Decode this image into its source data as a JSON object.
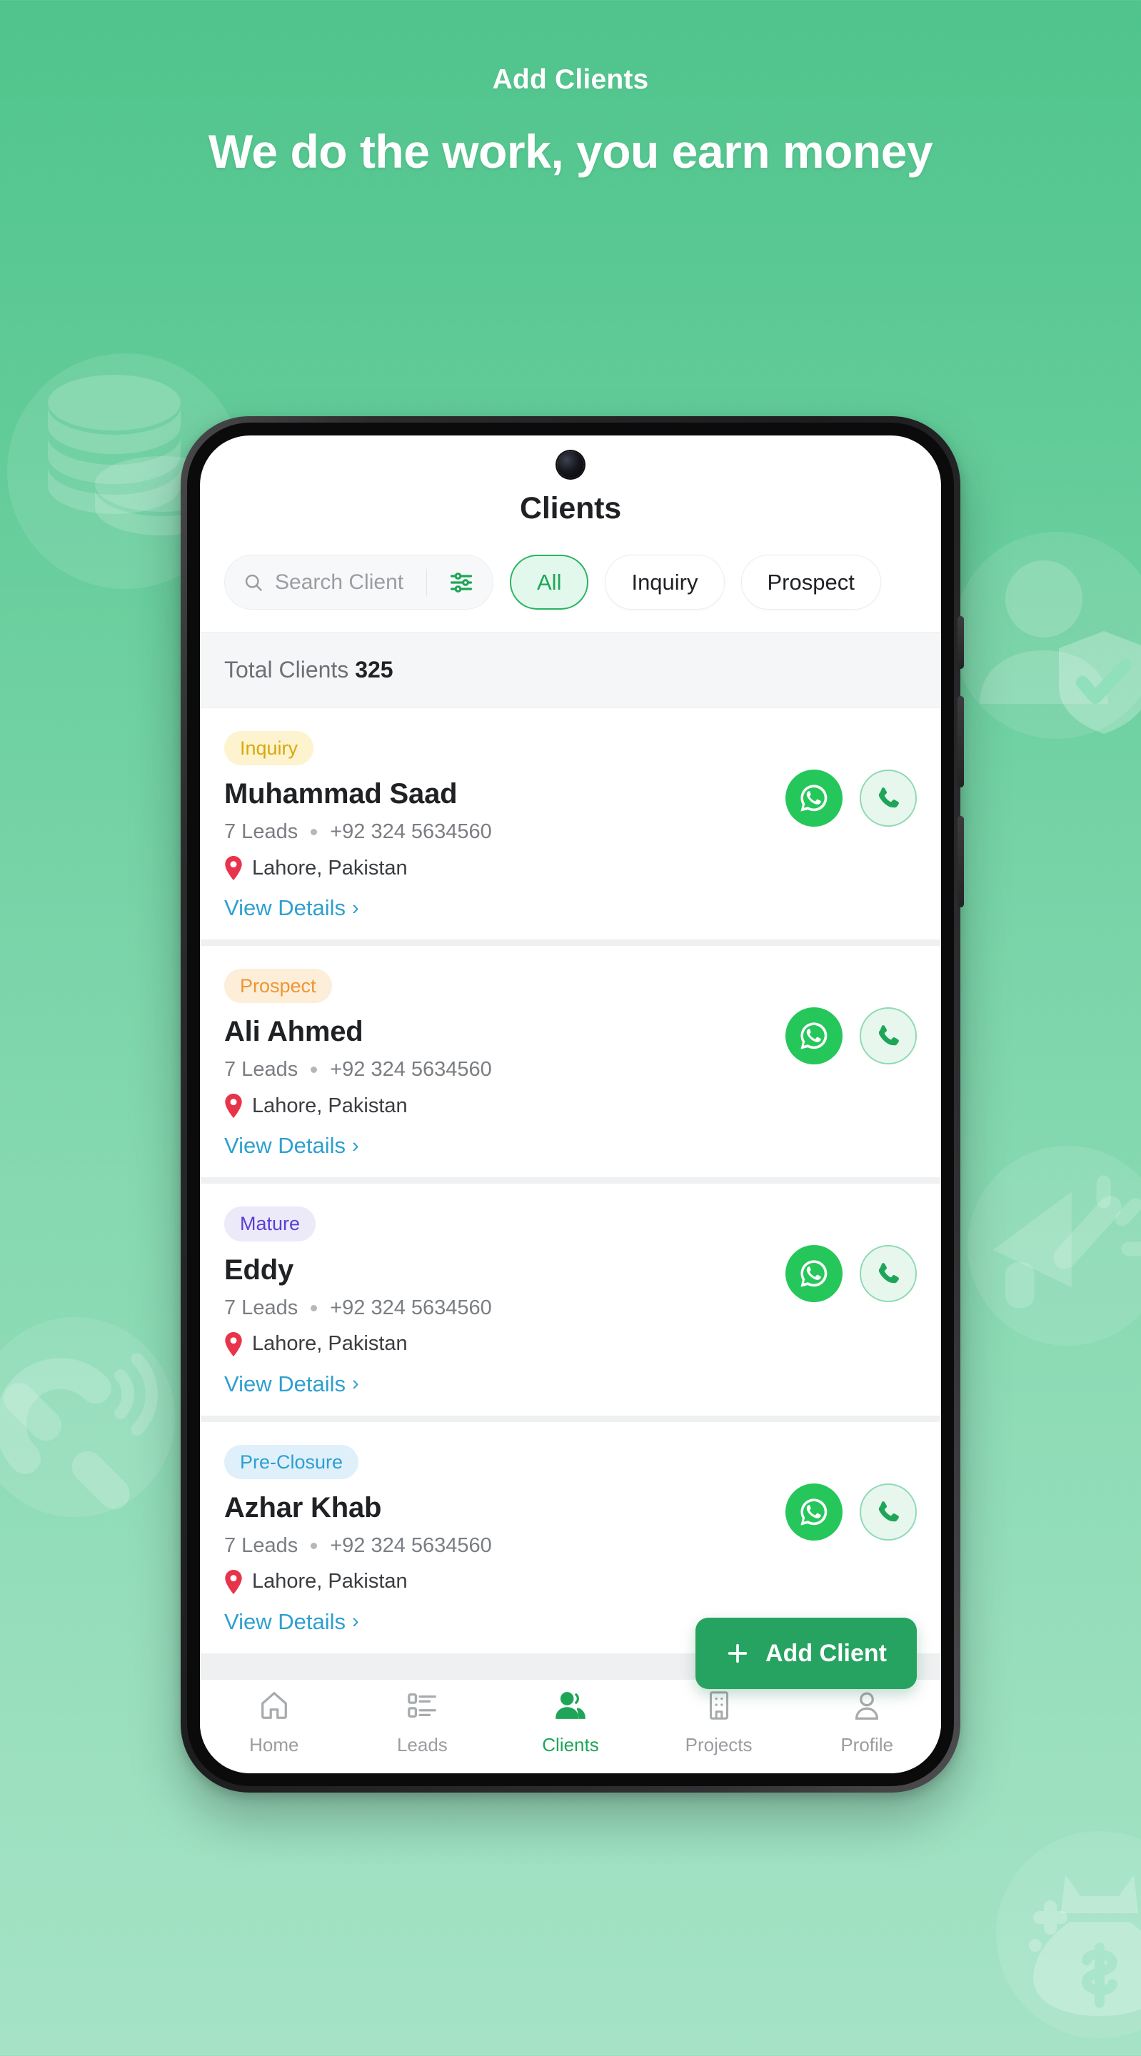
{
  "hero": {
    "eyebrow": "Add Clients",
    "title": "We do the work, you earn money"
  },
  "colors": {
    "brand_green": "#27a361",
    "accent_green": "#25c75a",
    "link_blue": "#2e9fd1",
    "pin_red": "#e8344a",
    "page_bg_top": "#4fc48c",
    "page_bg_bottom": "#a6e3c6"
  },
  "decorations": [
    {
      "name": "coins-icon"
    },
    {
      "name": "user-verified-icon"
    },
    {
      "name": "magnet-icon"
    },
    {
      "name": "megaphone-icon"
    },
    {
      "name": "money-bag-icon"
    }
  ],
  "app": {
    "title": "Clients",
    "search": {
      "placeholder": "Search Client",
      "value": ""
    },
    "chips": [
      {
        "label": "All",
        "active": true
      },
      {
        "label": "Inquiry",
        "active": false
      },
      {
        "label": "Prospect",
        "active": false
      }
    ],
    "total_label": "Total Clients",
    "total_count": "325",
    "view_details_label": "View Details",
    "chevron": "›",
    "add_button_label": "Add Client",
    "clients": [
      {
        "badge": "Inquiry",
        "badge_bg": "#fdf3cf",
        "badge_fg": "#d7a90c",
        "name": "Muhammad Saad",
        "leads": "7 Leads",
        "phone": "+92 324 5634560",
        "location": "Lahore, Pakistan"
      },
      {
        "badge": "Prospect",
        "badge_bg": "#fdeed9",
        "badge_fg": "#ef9533",
        "name": "Ali Ahmed",
        "leads": "7 Leads",
        "phone": "+92 324 5634560",
        "location": "Lahore, Pakistan"
      },
      {
        "badge": "Mature",
        "badge_bg": "#eceaf8",
        "badge_fg": "#5b3fd6",
        "name": "Eddy",
        "leads": "7 Leads",
        "phone": "+92 324 5634560",
        "location": "Lahore, Pakistan"
      },
      {
        "badge": "Pre-Closure",
        "badge_bg": "#dff0fb",
        "badge_fg": "#2e9fd1",
        "name": "Azhar Khab",
        "leads": "7 Leads",
        "phone": "+92 324 5634560",
        "location": "Lahore, Pakistan"
      }
    ],
    "nav": [
      {
        "label": "Home",
        "icon": "home-icon",
        "active": false
      },
      {
        "label": "Leads",
        "icon": "list-icon",
        "active": false
      },
      {
        "label": "Clients",
        "icon": "people-icon",
        "active": true
      },
      {
        "label": "Projects",
        "icon": "building-icon",
        "active": false
      },
      {
        "label": "Profile",
        "icon": "person-icon",
        "active": false
      }
    ]
  }
}
